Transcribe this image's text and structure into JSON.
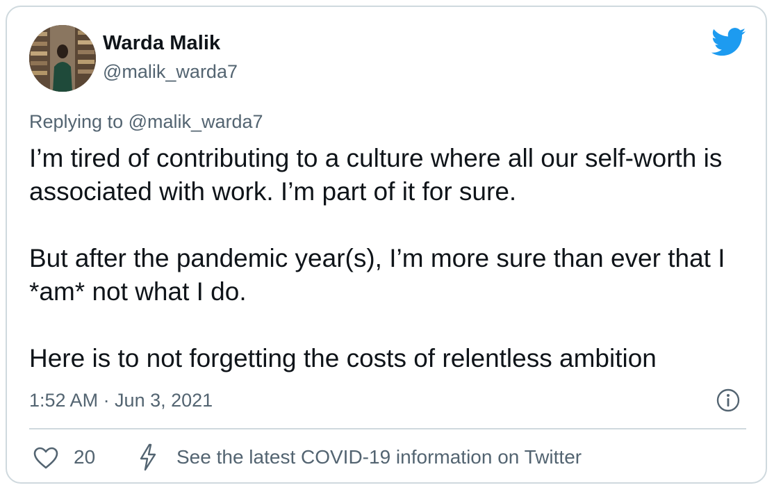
{
  "author": {
    "display_name": "Warda Malik",
    "handle": "@malik_warda7"
  },
  "reply": {
    "prefix": "Replying to ",
    "handle": "@malik_warda7"
  },
  "tweet": {
    "paragraph_1": "I’m tired of contributing to a culture where all our self-worth is associated with work. I’m part of it for sure.",
    "paragraph_2": "But after the pandemic year(s), I’m more sure than ever that I *am* not what I do.",
    "paragraph_3": "Here is to not forgetting the costs of relentless ambition"
  },
  "timestamp": "1:52 AM · Jun 3, 2021",
  "actions": {
    "like_count": "20",
    "covid_info": "See the latest COVID-19 information on Twitter"
  },
  "colors": {
    "twitter_blue": "#1d9bf0",
    "text_primary": "#0f1419",
    "text_secondary": "#536471",
    "border": "#cfd9de"
  },
  "icons": {
    "brand": "twitter-bird-icon",
    "info": "info-icon",
    "like": "heart-icon",
    "covid": "lightning-bolt-icon"
  }
}
